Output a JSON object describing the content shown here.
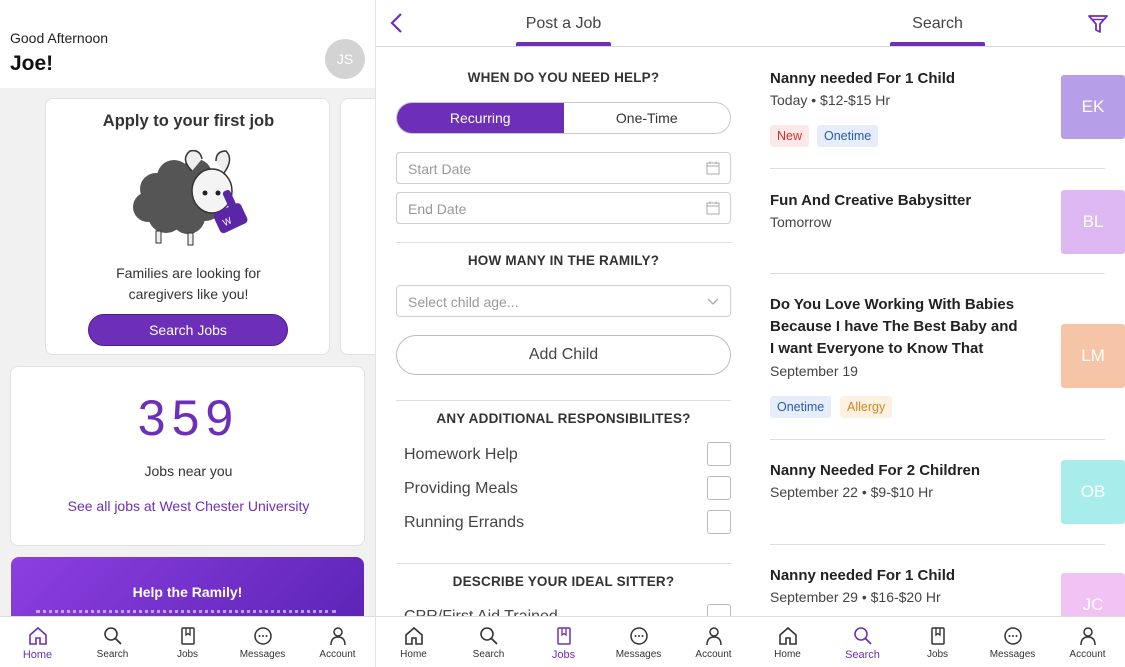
{
  "home": {
    "greeting": "Good Afternoon",
    "name": "Joe!",
    "avatar_initials": "JS",
    "apply_card": {
      "title": "Apply to your first job",
      "text": "Families are looking for caregivers like you!",
      "button": "Search Jobs"
    },
    "stats": {
      "count": "359",
      "label": "Jobs near you",
      "link": "See all jobs at West Chester University"
    },
    "promo": {
      "title": "Help the Ramily!"
    }
  },
  "post_job": {
    "title": "Post a Job",
    "when_heading": "WHEN DO YOU NEED HELP?",
    "segments": [
      "Recurring",
      "One-Time"
    ],
    "start_placeholder": "Start Date",
    "end_placeholder": "End Date",
    "how_many_heading": "HOW MANY IN THE RAMILY?",
    "child_age_placeholder": "Select child age...",
    "add_child": "Add Child",
    "resp_heading": "ANY ADDITIONAL RESPONSIBILITES?",
    "responsibilities": [
      "Homework Help",
      "Providing Meals",
      "Running Errands"
    ],
    "sitter_heading": "DESCRIBE YOUR IDEAL SITTER?",
    "sitter_first_item": "CPR/First Aid Trained"
  },
  "search": {
    "title": "Search",
    "jobs": [
      {
        "title": "Nanny needed For 1 Child",
        "meta": "Today • $12-$15 Hr",
        "initials": "EK",
        "color": "#b79ee8",
        "tags": [
          {
            "label": "New",
            "fg": "#d0312d",
            "bg": "#fde8e8"
          },
          {
            "label": "Onetime",
            "fg": "#2a5bb0",
            "bg": "#e6eefb"
          }
        ]
      },
      {
        "title": "Fun And Creative Babysitter",
        "meta": "Tomorrow",
        "initials": "BL",
        "color": "#ddb8f3",
        "tags": []
      },
      {
        "title": "Do You Love Working With Babies Because I have The Best Baby and I want Everyone to Know That",
        "meta": "September 19",
        "initials": "LM",
        "color": "#f6c4a7",
        "tags": [
          {
            "label": "Onetime",
            "fg": "#2a5bb0",
            "bg": "#e6eefb"
          },
          {
            "label": "Allergy",
            "fg": "#d4881c",
            "bg": "#fdf2e2"
          }
        ]
      },
      {
        "title": "Nanny Needed For 2 Children",
        "meta": "September 22 • $9-$10 Hr",
        "initials": "OB",
        "color": "#a8ecec",
        "tags": []
      },
      {
        "title": "Nanny needed For 1 Child",
        "meta": "September 29 • $16-$20 Hr",
        "initials": "JC",
        "color": "#f1c2f3",
        "tags": []
      }
    ]
  },
  "tabs": [
    "Home",
    "Search",
    "Jobs",
    "Messages",
    "Account"
  ],
  "active_tabs": {
    "panel1": "Home",
    "panel2": "Jobs",
    "panel3": "Search"
  },
  "colors": {
    "accent": "#6d2fb7"
  }
}
